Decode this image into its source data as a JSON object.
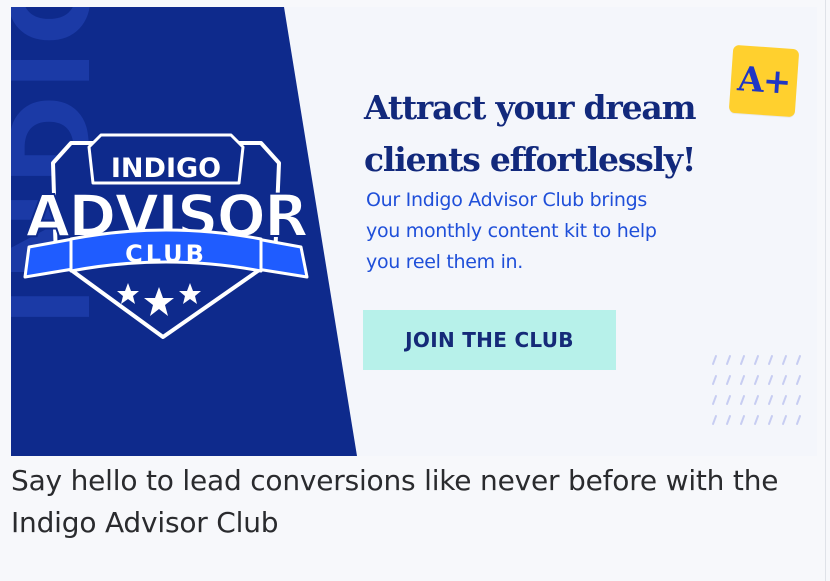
{
  "banner": {
    "badge": {
      "top_word": "INDIGO",
      "main_word": "ADVISOR",
      "ribbon_word": "CLUB",
      "watermark": "INDIGO"
    },
    "headline_line1": "Attract your dream",
    "headline_line2": "clients effortlessly!",
    "grade_tag": "A+",
    "sub_line1": "Our Indigo Advisor Club brings",
    "sub_line2": "you monthly content kit to help",
    "sub_line3": "you reel them in.",
    "cta_label": "JOIN THE CLUB"
  },
  "caption": "Say hello to lead conversions like never before with the Indigo Advisor Club",
  "colors": {
    "panel_navy": "#0e2a8c",
    "headline_navy": "#12297c",
    "sub_blue": "#1f4fd9",
    "cta_mint": "#b7f1ea",
    "tag_yellow": "#ffd02e",
    "ribbon_blue": "#1f5cff"
  },
  "icons": [
    "star-icon",
    "shield-badge-icon",
    "slash-pattern-decoration"
  ]
}
